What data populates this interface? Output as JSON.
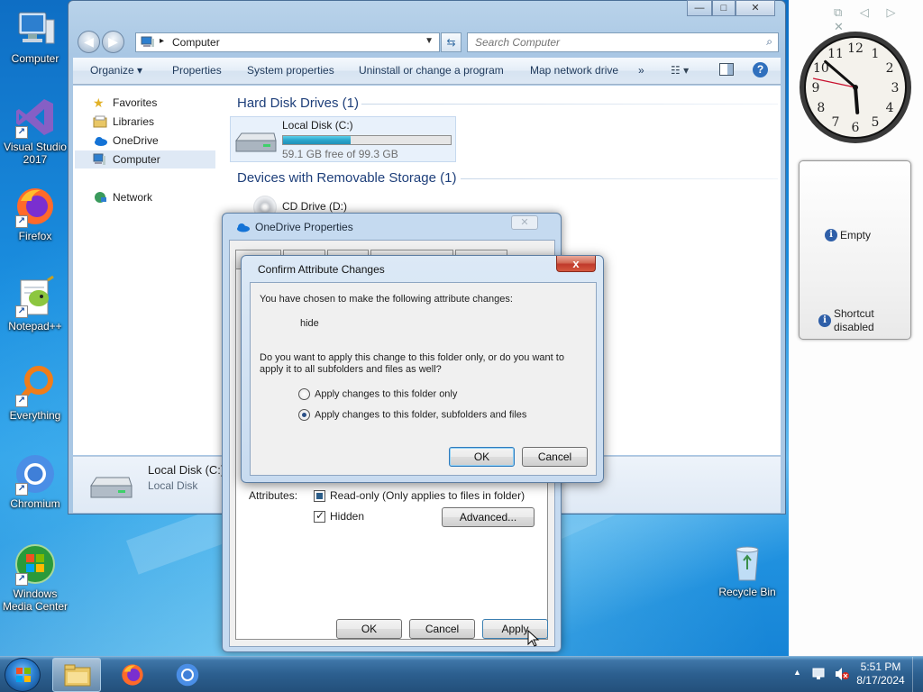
{
  "desktop": {
    "icons": [
      {
        "label": "Computer",
        "icon": "computer-icon"
      },
      {
        "label": "Visual Studio 2017",
        "icon": "visual-studio-icon"
      },
      {
        "label": "Firefox",
        "icon": "firefox-icon"
      },
      {
        "label": "Notepad++",
        "icon": "notepadpp-icon"
      },
      {
        "label": "Everything",
        "icon": "everything-icon"
      },
      {
        "label": "Chromium",
        "icon": "chromium-icon"
      },
      {
        "label": "Windows Media Center",
        "icon": "media-center-icon"
      },
      {
        "label": "Recycle Bin",
        "icon": "recycle-bin-icon"
      }
    ]
  },
  "gadgets": {
    "clock": {
      "hour": 5,
      "minute": 51,
      "second": 47
    },
    "info_items": [
      {
        "label": "Empty"
      },
      {
        "label": "Shortcut disabled"
      }
    ]
  },
  "explorer": {
    "address": "Computer",
    "search_placeholder": "Search Computer",
    "toolbar": {
      "organize": "Organize ▾",
      "properties": "Properties",
      "system_properties": "System properties",
      "uninstall": "Uninstall or change a program",
      "map_drive": "Map network drive",
      "more": "»"
    },
    "nav": {
      "favorites": "Favorites",
      "libraries": "Libraries",
      "onedrive": "OneDrive",
      "computer": "Computer",
      "network": "Network"
    },
    "groups": {
      "hard_disks": "Hard Disk Drives (1)",
      "removable": "Devices with Removable Storage (1)"
    },
    "drive_c": {
      "name": "Local Disk (C:)",
      "free": "59.1 GB free of 99.3 GB",
      "used_fraction": 0.405
    },
    "drive_d": {
      "name": "CD Drive (D:)"
    },
    "details": {
      "name": "Local Disk (C:)",
      "type": "Local Disk"
    }
  },
  "props_dialog": {
    "title": "OneDrive Properties",
    "attributes_label": "Attributes:",
    "readonly_label": "Read-only (Only applies to files in folder)",
    "hidden_label": "Hidden",
    "advanced_button": "Advanced...",
    "ok": "OK",
    "cancel": "Cancel",
    "apply": "Apply"
  },
  "confirm_dialog": {
    "title": "Confirm Attribute Changes",
    "intro": "You have chosen to make the following attribute changes:",
    "change": "hide",
    "question": "Do you want to apply this change to this folder only, or do you want to apply it to all subfolders and files as well?",
    "option1": "Apply changes to this folder only",
    "option2": "Apply changes to this folder, subfolders and files",
    "ok": "OK",
    "cancel": "Cancel",
    "close": "x"
  },
  "taskbar": {
    "time": "5:51 PM",
    "date": "8/17/2024"
  }
}
